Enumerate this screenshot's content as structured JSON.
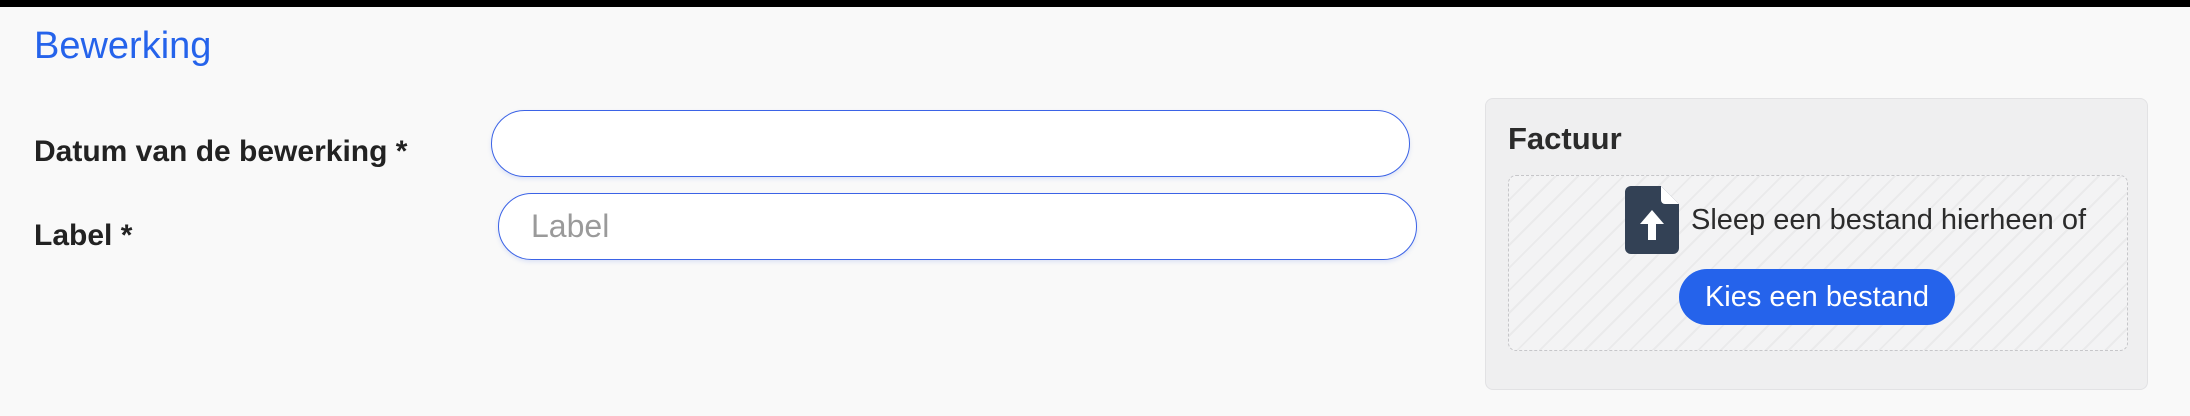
{
  "section": {
    "title": "Bewerking"
  },
  "form": {
    "date_label": "Datum van de bewerking *",
    "date_value": "",
    "date_placeholder": "",
    "label_label": "Label *",
    "label_value": "",
    "label_placeholder": "Label"
  },
  "invoice": {
    "title": "Factuur",
    "drop_text": "Sleep een bestand hierheen of",
    "choose_button": "Kies een bestand",
    "icon": "file-upload-icon"
  },
  "colors": {
    "accent": "#2563eb",
    "input_border": "#3b63e6",
    "file_icon": "#334155",
    "panel_bg": "#efeff0"
  }
}
